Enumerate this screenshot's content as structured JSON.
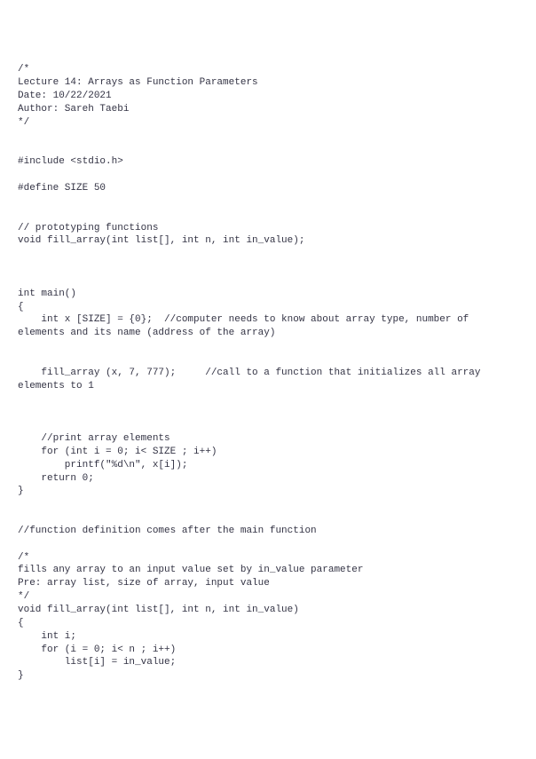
{
  "code_lines": [
    "/*",
    "Lecture 14: Arrays as Function Parameters",
    "Date: 10/22/2021",
    "Author: Sareh Taebi",
    "*/",
    "",
    "",
    "#include <stdio.h>",
    "",
    "#define SIZE 50",
    "",
    "",
    "// prototyping functions",
    "void fill_array(int list[], int n, int in_value);",
    "",
    "",
    "",
    "int main()",
    "{",
    "    int x [SIZE] = {0};  //computer needs to know about array type, number of elements and its name (address of the array)",
    "",
    "",
    "    fill_array (x, 7, 777);     //call to a function that initializes all array elements to 1",
    "",
    "",
    "",
    "    //print array elements",
    "    for (int i = 0; i< SIZE ; i++)",
    "        printf(\"%d\\n\", x[i]);",
    "    return 0;",
    "}",
    "",
    "",
    "//function definition comes after the main function",
    "",
    "/*",
    "fills any array to an input value set by in_value parameter",
    "Pre: array list, size of array, input value",
    "*/",
    "void fill_array(int list[], int n, int in_value)",
    "{",
    "    int i;",
    "    for (i = 0; i< n ; i++)",
    "        list[i] = in_value;",
    "}"
  ],
  "wrap_width": 80
}
